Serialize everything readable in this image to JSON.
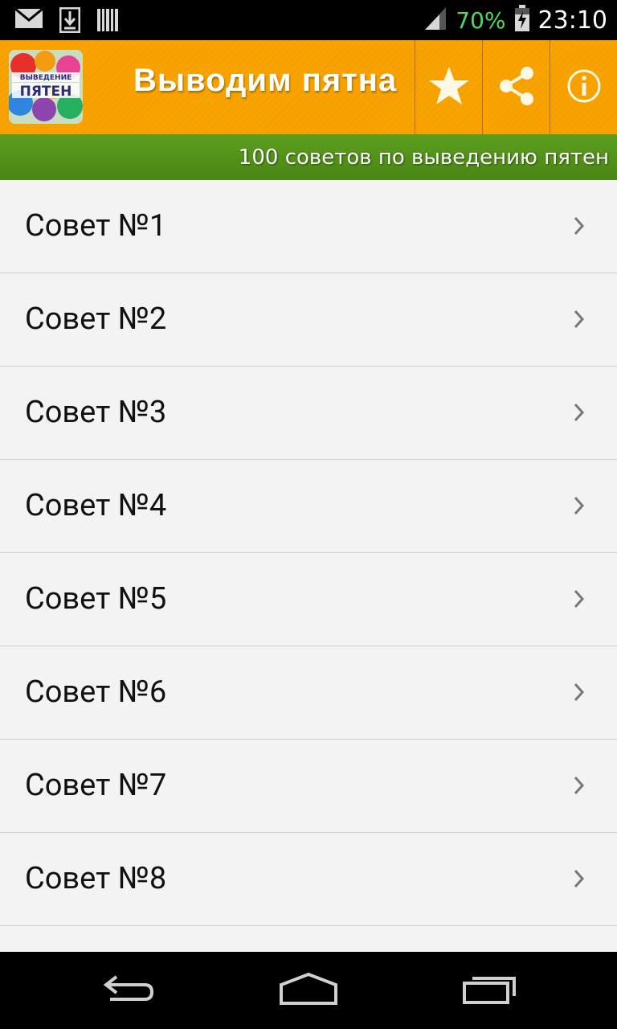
{
  "status_bar": {
    "battery_text": "70%",
    "time": "23:10"
  },
  "action_bar": {
    "logo_text_top": "ВЫВЕДЕНИЕ",
    "logo_text_bottom": "ПЯТЕН",
    "title": "Выводим пятна"
  },
  "subtitle": "100 советов по выведению пятен",
  "list": {
    "items": [
      {
        "label": "Совет №1"
      },
      {
        "label": "Совет №2"
      },
      {
        "label": "Совет №3"
      },
      {
        "label": "Совет №4"
      },
      {
        "label": "Совет №5"
      },
      {
        "label": "Совет №6"
      },
      {
        "label": "Совет №7"
      },
      {
        "label": "Совет №8"
      }
    ]
  },
  "colors": {
    "actionbar": "#f7a300",
    "subbar": "#53921a",
    "battery_text": "#4cd964"
  },
  "icons": {
    "status_left": [
      "mail-icon",
      "download-icon",
      "barcode-icon"
    ],
    "status_right": [
      "signal-icon",
      "battery-icon"
    ],
    "actions": [
      "star-icon",
      "share-icon",
      "info-icon"
    ],
    "nav": [
      "back-icon",
      "home-icon",
      "recent-apps-icon"
    ]
  }
}
